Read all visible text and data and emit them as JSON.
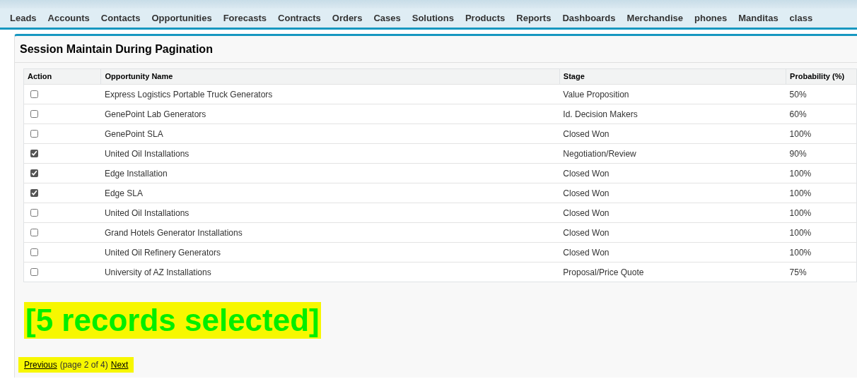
{
  "nav_tabs": [
    "Leads",
    "Accounts",
    "Contacts",
    "Opportunities",
    "Forecasts",
    "Contracts",
    "Orders",
    "Cases",
    "Solutions",
    "Products",
    "Reports",
    "Dashboards",
    "Merchandise",
    "phones",
    "Manditas",
    "class"
  ],
  "panel": {
    "title": "Session Maintain During Pagination"
  },
  "table": {
    "columns": [
      "Action",
      "Opportunity Name",
      "Stage",
      "Probability (%)"
    ],
    "rows": [
      {
        "checked": false,
        "name": "Express Logistics Portable Truck Generators",
        "stage": "Value Proposition",
        "probability": "50%"
      },
      {
        "checked": false,
        "name": "GenePoint Lab Generators",
        "stage": "Id. Decision Makers",
        "probability": "60%"
      },
      {
        "checked": false,
        "name": "GenePoint SLA",
        "stage": "Closed Won",
        "probability": "100%"
      },
      {
        "checked": true,
        "name": "United Oil Installations",
        "stage": "Negotiation/Review",
        "probability": "90%"
      },
      {
        "checked": true,
        "name": "Edge Installation",
        "stage": "Closed Won",
        "probability": "100%"
      },
      {
        "checked": true,
        "name": "Edge SLA",
        "stage": "Closed Won",
        "probability": "100%"
      },
      {
        "checked": false,
        "name": "United Oil Installations",
        "stage": "Closed Won",
        "probability": "100%"
      },
      {
        "checked": false,
        "name": "Grand Hotels Generator Installations",
        "stage": "Closed Won",
        "probability": "100%"
      },
      {
        "checked": false,
        "name": "United Oil Refinery Generators",
        "stage": "Closed Won",
        "probability": "100%"
      },
      {
        "checked": false,
        "name": "University of AZ Installations",
        "stage": "Proposal/Price Quote",
        "probability": "75%"
      }
    ]
  },
  "selection_count": "[5 records selected]",
  "pagination": {
    "previous": "Previous",
    "info": "(page 2 of 4)",
    "next": "Next"
  }
}
